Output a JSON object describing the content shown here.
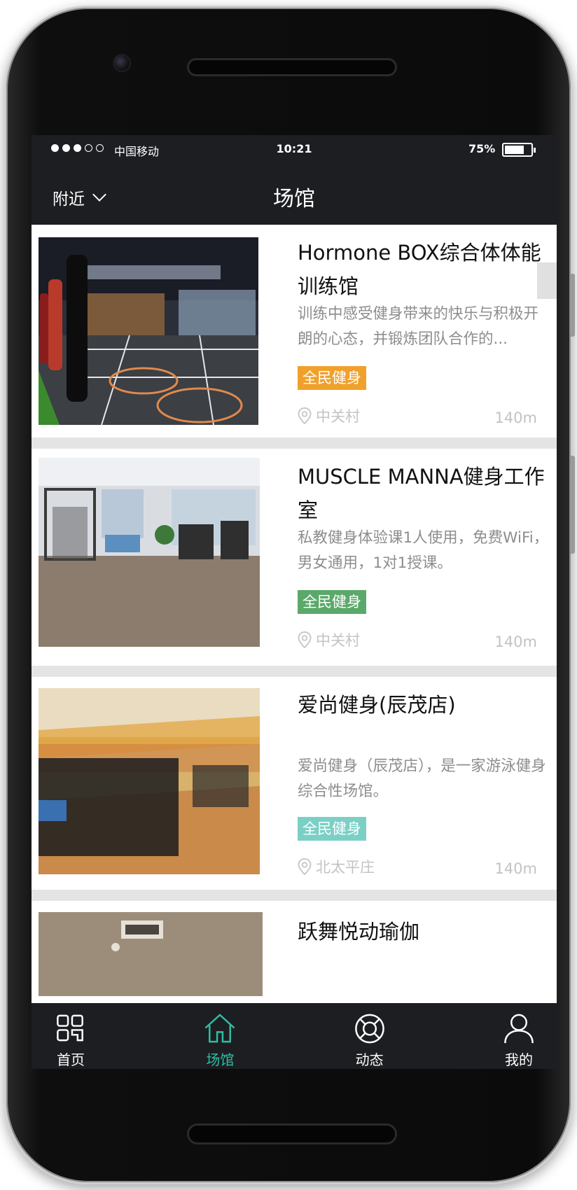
{
  "status_bar": {
    "carrier": "中国移动",
    "time": "10:21",
    "battery_percent_label": "75%",
    "battery_level": 0.75
  },
  "nav": {
    "location_label": "附近",
    "title": "场馆"
  },
  "venues": [
    {
      "title": "Hormone BOX综合体体能训练馆",
      "description": "训练中感受健身带来的快乐与积极开朗的心态，并锻炼团队合作的...",
      "tag": "全民健身",
      "tag_color": "#f0a12c",
      "area": "中关村",
      "distance": "140m"
    },
    {
      "title": "MUSCLE MANNA健身工作室",
      "description": "私教健身体验课1人使用，免费WiFi，男女通用，1对1授课。",
      "tag": "全民健身",
      "tag_color": "#5aa96a",
      "area": "中关村",
      "distance": "140m"
    },
    {
      "title": "爱尚健身(辰茂店)",
      "description": "爱尚健身（辰茂店），是一家游泳健身综合性场馆。",
      "tag": "全民健身",
      "tag_color": "#7bd0c6",
      "area": "北太平庄",
      "distance": "140m"
    },
    {
      "title": "跃舞悦动瑜伽"
    }
  ],
  "tabbar": {
    "items": [
      {
        "label": "首页",
        "icon": "grid-icon"
      },
      {
        "label": "场馆",
        "icon": "home-icon",
        "active": true,
        "color": "#2fbfa5"
      },
      {
        "label": "动态",
        "icon": "lifebuoy-icon"
      },
      {
        "label": "我的",
        "icon": "user-icon"
      }
    ]
  }
}
